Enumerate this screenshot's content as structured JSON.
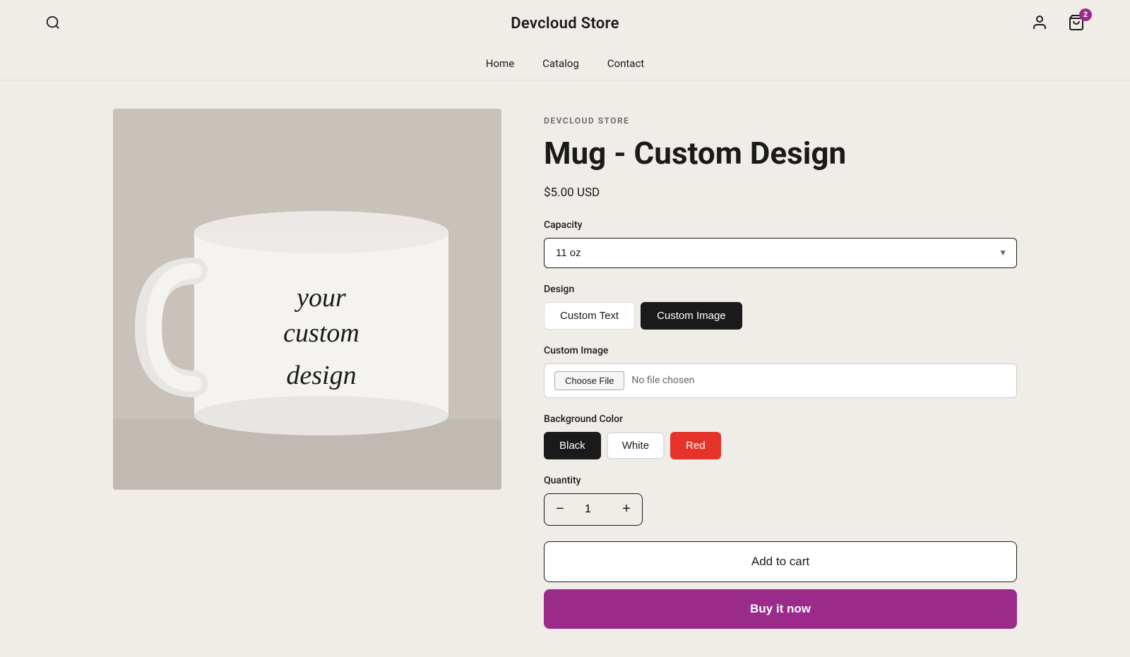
{
  "header": {
    "store_name": "Devcloud Store",
    "nav": {
      "home": "Home",
      "catalog": "Catalog",
      "contact": "Contact"
    },
    "cart_count": "2"
  },
  "product": {
    "brand": "DEVCLOUD STORE",
    "title": "Mug - Custom Design",
    "price": "$5.00 USD",
    "capacity_label": "Capacity",
    "capacity_value": "11 oz",
    "design_label": "Design",
    "design_custom_text": "Custom Text",
    "design_custom_image": "Custom Image",
    "custom_image_label": "Custom Image",
    "choose_file_btn": "Choose File",
    "no_file": "No file chosen",
    "background_color_label": "Background Color",
    "color_black": "Black",
    "color_white": "White",
    "color_red": "Red",
    "quantity_label": "Quantity",
    "quantity_value": "1",
    "add_to_cart": "Add to cart",
    "buy_now": "Buy it now"
  }
}
